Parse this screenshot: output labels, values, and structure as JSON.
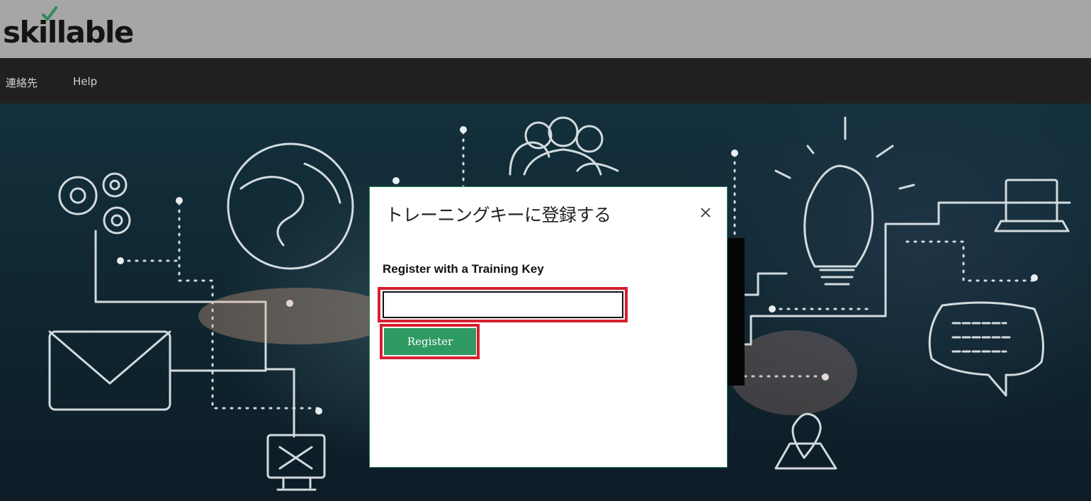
{
  "brand": {
    "logo_text": "skillable",
    "accent": "#2e8b57"
  },
  "nav": {
    "items": [
      {
        "label": "連絡先"
      },
      {
        "label": "Help"
      }
    ]
  },
  "modal": {
    "title": "トレーニングキーに登録する",
    "close_icon": "close-icon",
    "form_label": "Register with a Training Key",
    "key_input": {
      "value": "",
      "placeholder": ""
    },
    "register_label": "Register"
  },
  "colors": {
    "topbar": "#a6a6a6",
    "navbar": "#202020",
    "button": "#2e9a62",
    "highlight": "#d6202e"
  }
}
